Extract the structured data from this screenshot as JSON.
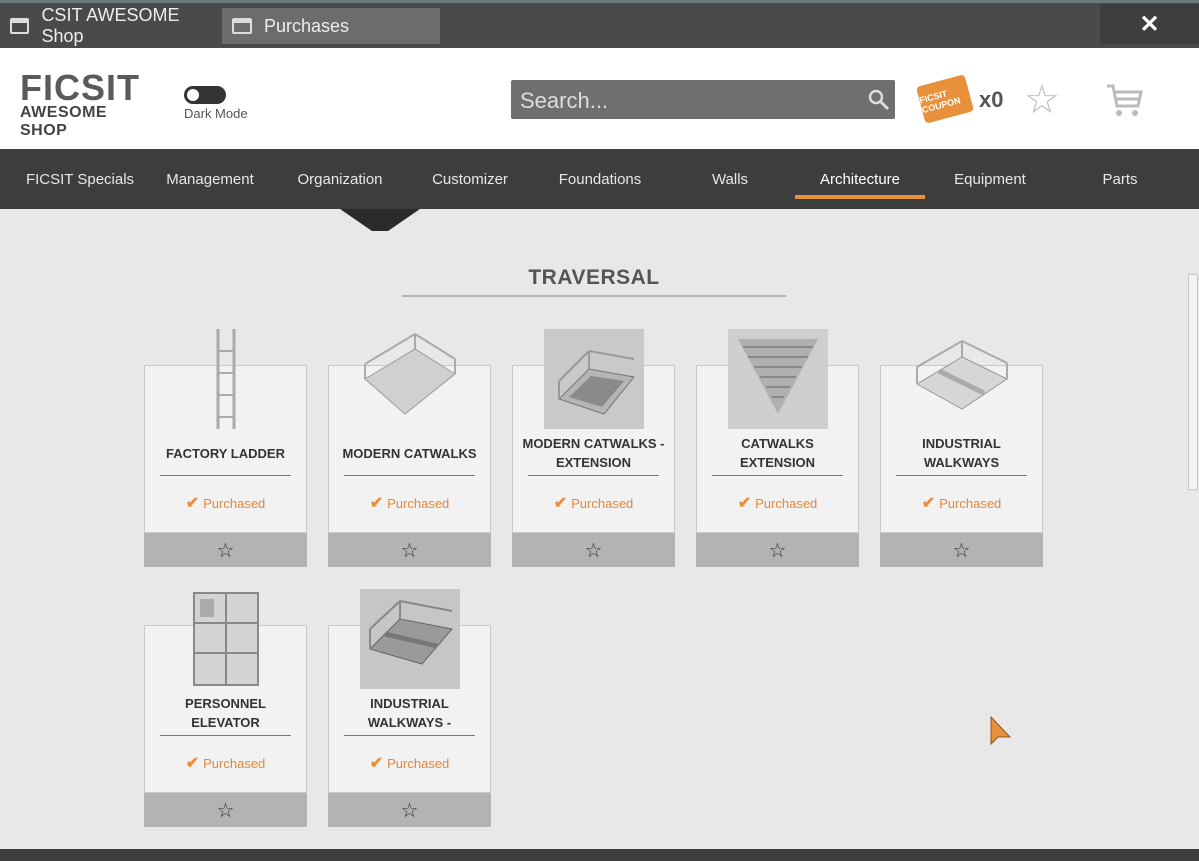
{
  "tabs": [
    {
      "label": "CSIT AWESOME Shop"
    },
    {
      "label": "Purchases"
    }
  ],
  "header": {
    "logo_main": "FICSIT",
    "logo_sub": "AWESOME SHOP",
    "dark_mode_label": "Dark Mode",
    "search_placeholder": "Search...",
    "coupon_text": "FICSIT COUPON",
    "coupon_count": "x0"
  },
  "nav": [
    {
      "label": "FICSIT Specials"
    },
    {
      "label": "Management"
    },
    {
      "label": "Organization"
    },
    {
      "label": "Customizer"
    },
    {
      "label": "Foundations"
    },
    {
      "label": "Walls"
    },
    {
      "label": "Architecture",
      "active": true
    },
    {
      "label": "Equipment"
    },
    {
      "label": "Parts"
    }
  ],
  "section": {
    "title": "TRAVERSAL"
  },
  "items": [
    {
      "name": "FACTORY LADDER",
      "status": "Purchased"
    },
    {
      "name": "MODERN CATWALKS",
      "status": "Purchased"
    },
    {
      "name": "MODERN CATWALKS - EXTENSION",
      "status": "Purchased"
    },
    {
      "name": "CATWALKS EXTENSION",
      "status": "Purchased"
    },
    {
      "name": "INDUSTRIAL WALKWAYS",
      "status": "Purchased"
    },
    {
      "name": "PERSONNEL ELEVATOR",
      "status": "Purchased"
    },
    {
      "name": "INDUSTRIAL WALKWAYS -",
      "status": "Purchased"
    }
  ],
  "colors": {
    "accent": "#e8913a",
    "nav_bg": "#3d3d3d"
  }
}
